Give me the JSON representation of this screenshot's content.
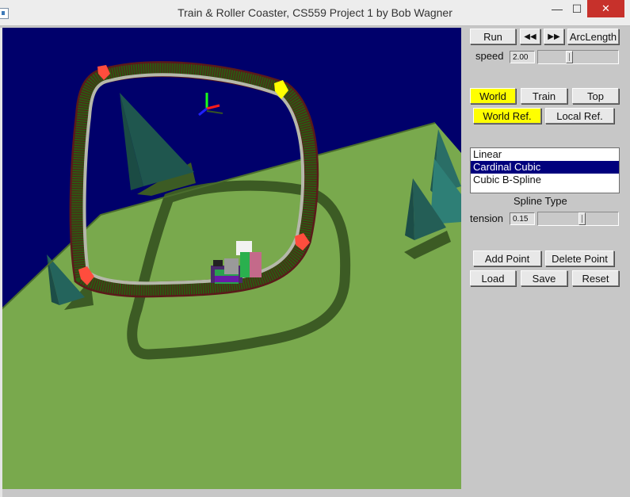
{
  "window": {
    "title": "Train & Roller Coaster, CS559 Project 1 by Bob Wagner",
    "minimize": "—",
    "maximize": "☐",
    "close": "✕"
  },
  "controls": {
    "run": "Run",
    "rewind_icon": "◀◀",
    "forward_icon": "▶▶",
    "arclength": "ArcLength",
    "speed_label": "speed",
    "speed_value": "2.00",
    "speed_fraction": 0.38,
    "view_buttons": [
      "World",
      "Train",
      "Top"
    ],
    "ref_buttons": [
      "World Ref.",
      "Local Ref."
    ],
    "highlight_color": "#ffff00",
    "spline_options": [
      "Linear",
      "Cardinal Cubic",
      "Cubic B-Spline"
    ],
    "spline_selected": "Cardinal Cubic",
    "spline_type_label": "Spline Type",
    "tension_label": "tension",
    "tension_value": "0.15",
    "tension_fraction": 0.55,
    "add_point": "Add Point",
    "delete_point": "Delete Point",
    "load": "Load",
    "save": "Save",
    "reset": "Reset"
  },
  "scene": {
    "sky_color": "#00006b",
    "ground_color": "#79a94d",
    "control_point_colors": [
      "#ff4d3d",
      "#ffff00",
      "#ff4d3d",
      "#ff4d3d",
      "#ff4d3d"
    ]
  }
}
